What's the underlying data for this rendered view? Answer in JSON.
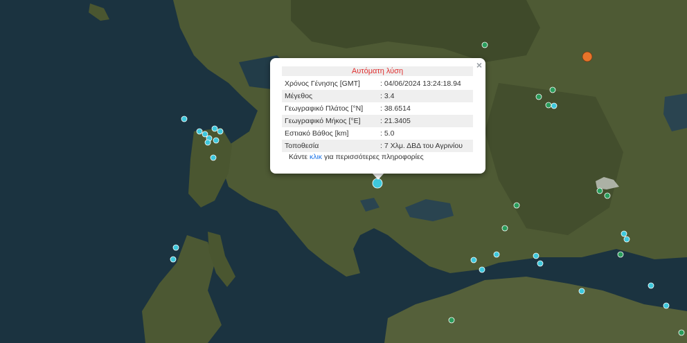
{
  "popup": {
    "title": "Αυτόματη λύση",
    "close_symbol": "×",
    "rows": [
      {
        "label": "Χρόνος Γένησης [GMT]",
        "value": ": 04/06/2024 13:24:18.94"
      },
      {
        "label": "Μέγεθος",
        "value": ": 3.4"
      },
      {
        "label": "Γεωγραφικό Πλάτος [°N]",
        "value": ": 38.6514"
      },
      {
        "label": "Γεωγραφικό Μήκος [°E]",
        "value": ": 21.3405"
      },
      {
        "label": "Εστιακό Βάθος [km]",
        "value": ": 5.0"
      },
      {
        "label": "Τοποθεσία",
        "value": ": 7 Χλμ. ΔΒΔ του Αγρινίου"
      }
    ],
    "more_prefix": "Κάντε ",
    "more_link": "κλικ",
    "more_suffix": " για περισσότερες πληροφορίες"
  },
  "colors": {
    "sea": "#1b3340",
    "land": "#4e5a34",
    "quake_cyan": "#3ec8dc",
    "quake_green": "#2a9d5c",
    "quake_orange": "#e8742a",
    "popup_title": "#e03030"
  }
}
